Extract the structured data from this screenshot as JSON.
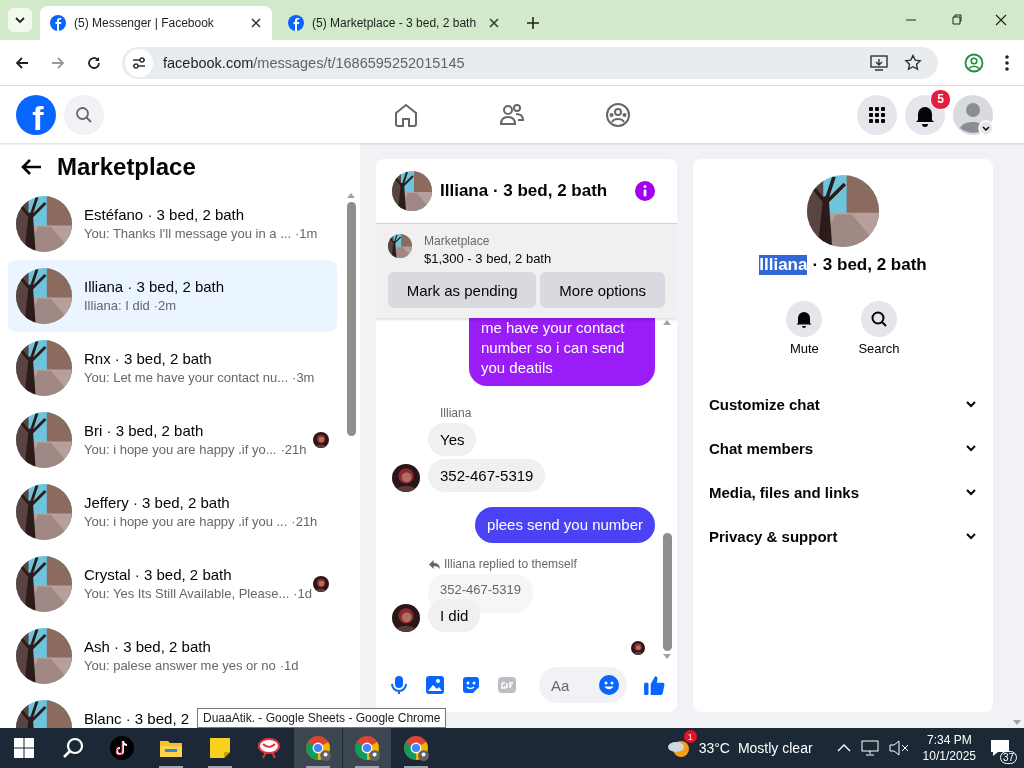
{
  "browser": {
    "tabs": [
      {
        "title": "(5) Messenger | Facebook",
        "selected": true
      },
      {
        "title": "(5) Marketplace - 3 bed, 2 bath",
        "selected": false
      }
    ],
    "url_host": "facebook.com",
    "url_path": "/messages/t/1686595252015145"
  },
  "header": {
    "logo": "f",
    "notification_count": "5"
  },
  "sidebar": {
    "title": "Marketplace",
    "conversations": [
      {
        "name": "Estéfano · 3 bed, 2 bath",
        "preview": "You: Thanks I'll message you in a ...",
        "time": "·1m",
        "selected": false,
        "seen": false
      },
      {
        "name": "Illiana · 3 bed, 2 bath",
        "preview": "Illiana: I did",
        "time": "·2m",
        "selected": true,
        "seen": false
      },
      {
        "name": "Rnx · 3 bed, 2 bath",
        "preview": "You: Let me have your contact nu...",
        "time": "·3m",
        "selected": false,
        "seen": false
      },
      {
        "name": "Bri · 3 bed, 2 bath",
        "preview": "You: i hope you are happy .if yo...",
        "time": "·21h",
        "selected": false,
        "seen": true
      },
      {
        "name": "Jeffery · 3 bed, 2 bath",
        "preview": "You: i hope you are happy .if you ...",
        "time": "·21h",
        "selected": false,
        "seen": false
      },
      {
        "name": "Crystal · 3 bed, 2 bath",
        "preview": "You: Yes Its Still Available, Please...",
        "time": "·1d",
        "selected": false,
        "seen": true
      },
      {
        "name": "Ash · 3 bed, 2 bath",
        "preview": "You: palese answer me yes or no",
        "time": "·1d",
        "selected": false,
        "seen": false
      },
      {
        "name": "Blanc · 3 bed, 2",
        "selected": false,
        "seen": false
      }
    ]
  },
  "chat": {
    "title": "Illiana · 3 bed, 2 bath",
    "listing": {
      "source": "Marketplace",
      "summary": "$1,300 - 3 bed, 2 bath"
    },
    "actions": [
      "Mark as pending",
      "More options"
    ],
    "messages": [
      {
        "kind": "outgoing",
        "text": "me have your contact number so i can send you deatils",
        "color": "#9a1cf6",
        "clipped": true
      },
      {
        "kind": "sender",
        "text": "Illiana"
      },
      {
        "kind": "incoming",
        "text": "Yes",
        "avatar": false
      },
      {
        "kind": "incoming",
        "text": "352-467-5319",
        "avatar": true
      },
      {
        "kind": "outgoing",
        "text": "plees send you number",
        "color": "#4a42f4",
        "clipped": false
      },
      {
        "kind": "reply_note",
        "text": "Illiana replied to themself"
      },
      {
        "kind": "quote",
        "text": "352-467-5319"
      },
      {
        "kind": "incoming",
        "text": "I did",
        "avatar": true
      },
      {
        "kind": "seen"
      }
    ],
    "composer": {
      "placeholder": "Aa"
    }
  },
  "info": {
    "name_selected": "Illiana",
    "name_rest": "· 3 bed, 2 bath",
    "actions": [
      {
        "kind": "mute",
        "label": "Mute"
      },
      {
        "kind": "search",
        "label": "Search"
      }
    ],
    "sections": [
      {
        "label": "Customize chat",
        "expanded": false
      },
      {
        "label": "Chat members",
        "expanded": false
      },
      {
        "label": "Media, files and links",
        "expanded": false
      },
      {
        "label": "Privacy & support",
        "expanded": false
      }
    ]
  },
  "tooltip": "DuaaAtik. - Google Sheets - Google Chrome",
  "taskbar": {
    "apps": [
      {
        "kind": "start",
        "open": false,
        "active": false
      },
      {
        "kind": "search",
        "open": false,
        "active": false
      },
      {
        "kind": "tiktok",
        "open": false,
        "active": false
      },
      {
        "kind": "explorer",
        "open": true,
        "active": false
      },
      {
        "kind": "sticky",
        "open": true,
        "active": false
      },
      {
        "kind": "snip",
        "open": false,
        "active": false
      },
      {
        "kind": "chrome",
        "open": true,
        "active": true
      },
      {
        "kind": "chrome",
        "open": true,
        "active": true
      },
      {
        "kind": "chrome",
        "open": true,
        "active": false
      }
    ],
    "weather_badge": "1",
    "temperature": "33°C",
    "condition": "Mostly clear",
    "time": "7:34 PM",
    "date": "10/1/2025",
    "notifications": "37"
  }
}
